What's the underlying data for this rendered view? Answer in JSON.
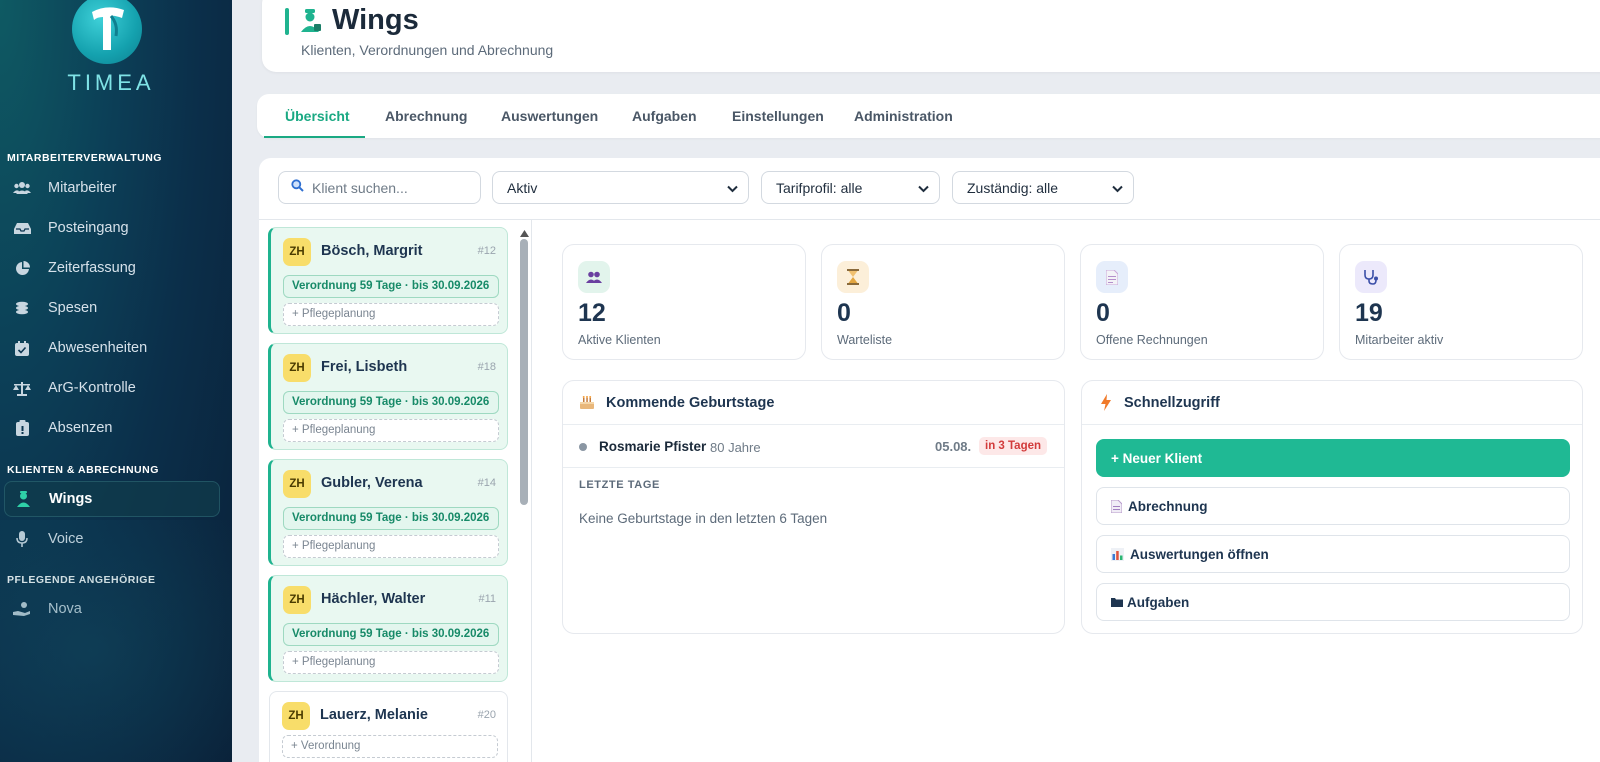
{
  "brand": {
    "name": "TIMEA",
    "accent": "#1fb38f"
  },
  "sidebar": {
    "sections": [
      {
        "label": "MITARBEITERVERWALTUNG"
      },
      {
        "label": "KLIENTEN & ABRECHNUNG"
      },
      {
        "label": "PFLEGENDE ANGEHÖRIGE"
      }
    ],
    "items": [
      {
        "label": "Mitarbeiter",
        "icon": "users-icon"
      },
      {
        "label": "Posteingang",
        "icon": "inbox-icon"
      },
      {
        "label": "Zeiterfassung",
        "icon": "pie-chart-icon"
      },
      {
        "label": "Spesen",
        "icon": "coins-icon"
      },
      {
        "label": "Abwesenheiten",
        "icon": "calendar-check-icon"
      },
      {
        "label": "ArG-Kontrolle",
        "icon": "scale-icon"
      },
      {
        "label": "Absenzen",
        "icon": "clipboard-icon"
      },
      {
        "label": "Wings",
        "icon": "nurse-icon",
        "active": true
      },
      {
        "label": "Voice",
        "icon": "microphone-icon"
      },
      {
        "label": "Nova",
        "icon": "hand-care-icon"
      }
    ]
  },
  "header": {
    "title": "Wings",
    "subtitle": "Klienten, Verordnungen und Abrechnung"
  },
  "tabs": [
    {
      "label": "Übersicht",
      "active": true
    },
    {
      "label": "Abrechnung"
    },
    {
      "label": "Auswertungen"
    },
    {
      "label": "Aufgaben"
    },
    {
      "label": "Einstellungen"
    },
    {
      "label": "Administration"
    }
  ],
  "filters": {
    "search_placeholder": "Klient suchen...",
    "status": "Aktiv",
    "tarif": "Tarifprofil: alle",
    "zustaendig": "Zuständig: alle"
  },
  "clients": [
    {
      "canton": "ZH",
      "name": "Bösch, Margrit",
      "id": "#12",
      "verordnung": "Verordnung 59 Tage · bis 30.09.2026",
      "action": "+ Pflegeplanung"
    },
    {
      "canton": "ZH",
      "name": "Frei, Lisbeth",
      "id": "#18",
      "verordnung": "Verordnung 59 Tage · bis 30.09.2026",
      "action": "+ Pflegeplanung"
    },
    {
      "canton": "ZH",
      "name": "Gubler, Verena",
      "id": "#14",
      "verordnung": "Verordnung 59 Tage · bis 30.09.2026",
      "action": "+ Pflegeplanung"
    },
    {
      "canton": "ZH",
      "name": "Hächler, Walter",
      "id": "#11",
      "verordnung": "Verordnung 59 Tage · bis 30.09.2026",
      "action": "+ Pflegeplanung"
    },
    {
      "canton": "ZH",
      "name": "Lauerz, Melanie",
      "id": "#20",
      "action": "+ Verordnung"
    }
  ],
  "stats": [
    {
      "value": "12",
      "label": "Aktive Klienten",
      "icon": "people-icon"
    },
    {
      "value": "0",
      "label": "Warteliste",
      "icon": "hourglass-icon"
    },
    {
      "value": "0",
      "label": "Offene Rechnungen",
      "icon": "invoice-icon"
    },
    {
      "value": "19",
      "label": "Mitarbeiter aktiv",
      "icon": "stethoscope-icon"
    }
  ],
  "birthdays": {
    "title": "Kommende Geburtstage",
    "upcoming": [
      {
        "name": "Rosmarie Pfister",
        "age": "80 Jahre",
        "date": "05.08.",
        "badge": "in 3 Tagen"
      }
    ],
    "recent_label": "LETZTE TAGE",
    "recent_empty": "Keine Geburtstage in den letzten 6 Tagen"
  },
  "quick": {
    "title": "Schnellzugriff",
    "buttons": [
      {
        "label": "+  Neuer Klient"
      },
      {
        "label": "Abrechnung"
      },
      {
        "label": "Auswertungen öffnen"
      },
      {
        "label": "Aufgaben"
      }
    ]
  }
}
